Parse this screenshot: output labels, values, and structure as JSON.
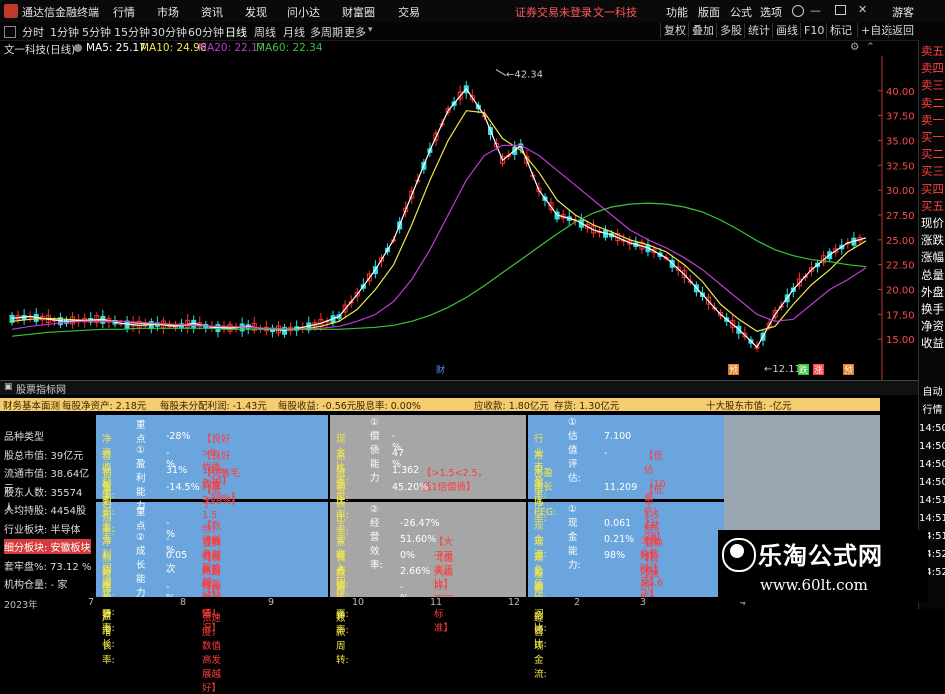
{
  "app": {
    "title": "通达信金融终端",
    "menu": [
      "行情",
      "市场",
      "资讯",
      "发现",
      "问小达",
      "财富圈",
      "交易"
    ],
    "login_status": "证券交易未登录",
    "company_short": "文一科技",
    "window_controls": [
      "功能",
      "版面",
      "公式",
      "选项",
      "游客"
    ]
  },
  "toolbar": {
    "timeframes": [
      "分时",
      "1分钟",
      "5分钟",
      "15分钟",
      "30分钟",
      "60分钟",
      "日线",
      "周线",
      "月线",
      "多周期",
      "更多"
    ],
    "active_timeframe": "日线",
    "right_buttons": [
      "复权",
      "叠加",
      "多股",
      "统计",
      "画线",
      "F10",
      "标记",
      "+自选",
      "返回"
    ]
  },
  "indicator_bar": {
    "stock_label": "文一科技(日线)",
    "ma5": "MA5: 25.17",
    "ma10": "MA10: 24.96",
    "ma20": "MA20: 22.17",
    "ma60": "MA60: 22.34"
  },
  "colors": {
    "ma5": "#ffffff",
    "ma10": "#f2e64b",
    "ma20": "#c03ad6",
    "ma60": "#39c43a",
    "up": "#ff3030",
    "down": "#33e0e0",
    "accent_red": "#ff3b3b",
    "panel_blue": "#6aa6dd",
    "panel_grey": "#a6a6a6",
    "panel_bar": "#f5cd6e"
  },
  "chart_data": {
    "type": "line",
    "title": "",
    "xlabel": "",
    "ylabel": "",
    "ylim": [
      11.5,
      43.5
    ],
    "y_ticks": [
      "40.00",
      "37.50",
      "35.00",
      "32.50",
      "30.00",
      "27.50",
      "25.00",
      "22.50",
      "20.00",
      "17.50",
      "15.00"
    ],
    "annotations": {
      "high": "42.34",
      "low": "12.11"
    },
    "x_date_labels": [
      "2023年",
      "7",
      "8",
      "9",
      "10",
      "11",
      "12",
      "2",
      "3",
      "4"
    ],
    "event_markers": [
      "财",
      "预",
      "跌",
      "涨",
      "预"
    ],
    "series": [
      {
        "name": "MA5",
        "values": [
          17.1,
          17.3,
          17.0,
          16.8,
          16.9,
          17.0,
          16.6,
          16.4,
          16.5,
          16.3,
          16.6,
          16.2,
          16.1,
          16.3,
          16.0,
          15.9,
          16.2,
          16.6,
          17.3,
          19.5,
          22.0,
          25.0,
          29.5,
          34.0,
          38.0,
          40.2,
          37.5,
          33.0,
          34.5,
          30.0,
          27.5,
          27.0,
          26.0,
          25.5,
          24.7,
          24.2,
          23.2,
          21.5,
          19.5,
          17.5,
          16.0,
          14.2,
          17.5,
          20.0,
          22.0,
          23.5,
          24.7,
          25.2
        ]
      },
      {
        "name": "MA10",
        "values": [
          16.8,
          17.0,
          17.1,
          17.0,
          16.9,
          16.9,
          16.8,
          16.6,
          16.5,
          16.4,
          16.4,
          16.3,
          16.2,
          16.2,
          16.1,
          16.0,
          16.0,
          16.3,
          16.8,
          18.0,
          20.0,
          22.5,
          26.5,
          31.0,
          35.0,
          38.0,
          37.8,
          35.2,
          34.0,
          31.8,
          29.0,
          27.5,
          26.5,
          25.8,
          25.0,
          24.5,
          23.8,
          22.5,
          20.8,
          18.5,
          17.0,
          15.8,
          16.3,
          18.5,
          20.5,
          22.0,
          23.8,
          24.9
        ]
      },
      {
        "name": "MA20",
        "values": [
          16.0,
          16.3,
          16.5,
          16.7,
          16.8,
          16.8,
          16.8,
          16.7,
          16.6,
          16.5,
          16.4,
          16.3,
          16.3,
          16.2,
          16.1,
          16.1,
          16.0,
          16.1,
          16.3,
          16.8,
          17.5,
          18.8,
          21.0,
          24.0,
          27.5,
          31.0,
          33.5,
          34.5,
          34.5,
          33.5,
          32.0,
          30.5,
          29.0,
          27.5,
          26.0,
          25.0,
          24.2,
          23.2,
          22.0,
          20.5,
          19.0,
          17.5,
          16.8,
          17.0,
          18.5,
          20.0,
          21.0,
          22.2
        ]
      },
      {
        "name": "MA60",
        "values": [
          15.3,
          15.5,
          15.7,
          15.8,
          15.9,
          16.0,
          16.0,
          16.1,
          16.1,
          16.1,
          16.1,
          16.1,
          16.0,
          16.0,
          16.0,
          16.0,
          16.0,
          16.0,
          16.0,
          16.1,
          16.2,
          16.4,
          16.8,
          17.4,
          18.2,
          19.2,
          20.4,
          21.7,
          23.0,
          24.3,
          25.6,
          26.8,
          27.7,
          28.3,
          28.6,
          28.7,
          28.6,
          28.3,
          27.8,
          27.0,
          26.0,
          24.9,
          24.0,
          23.4,
          23.0,
          22.8,
          22.5,
          22.3
        ]
      }
    ]
  },
  "right_panel": {
    "items": [
      {
        "label": "卖五",
        "type": "sell"
      },
      {
        "label": "卖四",
        "type": "sell"
      },
      {
        "label": "卖三",
        "type": "sell"
      },
      {
        "label": "卖二",
        "type": "sell"
      },
      {
        "label": "卖一",
        "type": "sell"
      },
      {
        "label": "买一",
        "type": "buy"
      },
      {
        "label": "买二",
        "type": "buy"
      },
      {
        "label": "买三",
        "type": "buy"
      },
      {
        "label": "买四",
        "type": "buy"
      },
      {
        "label": "买五",
        "type": "buy"
      },
      {
        "label": "现价",
        "type": "info"
      },
      {
        "label": "涨跌",
        "type": "info"
      },
      {
        "label": "涨幅",
        "type": "info"
      },
      {
        "label": "总量",
        "type": "info"
      },
      {
        "label": "外盘",
        "type": "info"
      },
      {
        "label": "换手",
        "type": "info"
      },
      {
        "label": "净资",
        "type": "info"
      },
      {
        "label": "收益",
        "type": "info"
      }
    ],
    "lower_items": [
      "自动",
      "行情",
      "14:50",
      "14:50",
      "14:50",
      "14:50",
      "14:51",
      "14:51",
      "14:51",
      "14:52",
      "14:52"
    ]
  },
  "panel": {
    "tab": "股票指标网",
    "summary": {
      "title": "财务基本面测",
      "nav_per_share": "每股净资产: 2.18元",
      "undistributed": "每股未分配利润: -1.43元",
      "eps": "每股收益: -0.56元",
      "dividend": "股息率: 0.00%",
      "receivable": "应收款: 1.80亿元",
      "inventory": "存货: 1.30亿元",
      "top10": "十大股东市值: -亿元"
    },
    "left_list": [
      "品种类型",
      "股总市值: 39亿元",
      "流通市值: 38.64亿元",
      "股东人数: 35574人",
      "人均持股: 4454股",
      "行业板块: 半导体",
      "细分板块: 安徽板块",
      "套牢盘%: 73.12 %",
      "机构仓量: - 家"
    ],
    "profit": {
      "caption": "重点① 盈利能力",
      "rows": [
        {
          "label": "净资收益率:",
          "val": "-28%",
          "tag": "【良好>8，优秀>10】"
        },
        {
          "label": "营业利润率:",
          "val": "-%",
          "tag": "【良好10%，优秀>20%】"
        },
        {
          "label": "销售毛利率:",
          "val": "31%",
          "tag": "【销售毛利率>20%】"
        },
        {
          "label": "净利润率:",
          "val": "-14.5%",
          "tag": "【低于1.5倍，要换价格】"
        }
      ]
    },
    "debt": {
      "caption": "①偿债能力",
      "rows": [
        {
          "label": "现金比率:",
          "val": "-%",
          "tag": ""
        },
        {
          "label": "总负债率:",
          "val": "47 %",
          "tag": ""
        },
        {
          "label": "流动比率:",
          "val": "1.362",
          "tag": "【>1.5<2.5，低1倍偿债】"
        },
        {
          "label": "负债比率:",
          "val": "45.20%",
          "tag": ""
        }
      ]
    },
    "valuation": {
      "caption": "①估值评估:",
      "rows": [
        {
          "label": "行业市盈率:",
          "val": "7.100",
          "tag": ""
        },
        {
          "label": "市盈率:",
          "val": "-",
          "tag": "【低估（10高估）21-28】"
        },
        {
          "label": "市盈增长比PEG:",
          "val": "",
          "tag": ""
        },
        {
          "label": "市净率:",
          "val": "11.209",
          "tag": "【低于1.5倍，要换价格】"
        }
      ]
    },
    "growth": {
      "caption": "重点② 成长能力",
      "rows": [
        {
          "label": "主营利润增长:",
          "val": "-%",
          "tag": "【数值越高对股价越好】"
        },
        {
          "label": "净利润增长率:",
          "val": "-%",
          "tag": "【数值越高盈利能力越强】"
        },
        {
          "label": "总资产周转率:",
          "val": "0.05次",
          "tag": "【资产规模的增长情况】"
        },
        {
          "label": "投资收益增长:",
          "val": "-",
          "tag": ""
        },
        {
          "label": "净资产增长率:",
          "val": "-%",
          "tag": "【规模扩张速度，数值高发展越好】"
        }
      ]
    },
    "operation": {
      "caption": "②经营效率:",
      "rows": [
        {
          "label": "主营收入同比:",
          "val": "-26.47%",
          "tag": ""
        },
        {
          "label": "主营占比:",
          "val": "51.60%",
          "tag": "【大于不高正比】"
        },
        {
          "label": "优质资产率:",
          "val": "0%",
          "tag": "【越大越好，不同标准】"
        },
        {
          "label": "存货周转率:",
          "val": "2.66%",
          "tag": ""
        },
        {
          "label": "应收账款周转:",
          "val": "-%",
          "tag": ""
        }
      ]
    },
    "cash": {
      "caption": "①现金能力:",
      "rows": [
        {
          "label": "现金流:",
          "val": "0.061",
          "tag": "【减少负负数时注意】"
        },
        {
          "label": "现金负债比:",
          "val": "0.21%",
          "tag": "【良好】"
        },
        {
          "label": "现金流利润比:",
          "val": "98%",
          "tag": "【良好>0.6优】"
        },
        {
          "label": "股价现金流比:",
          "val": "",
          "tag": "【流动】0.0"
        },
        {
          "label": "每股经营现金流:",
          "val": "",
          "tag": ""
        }
      ]
    }
  },
  "watermark": {
    "brand": "乐淘公式网",
    "url": "www.60lt.com"
  }
}
